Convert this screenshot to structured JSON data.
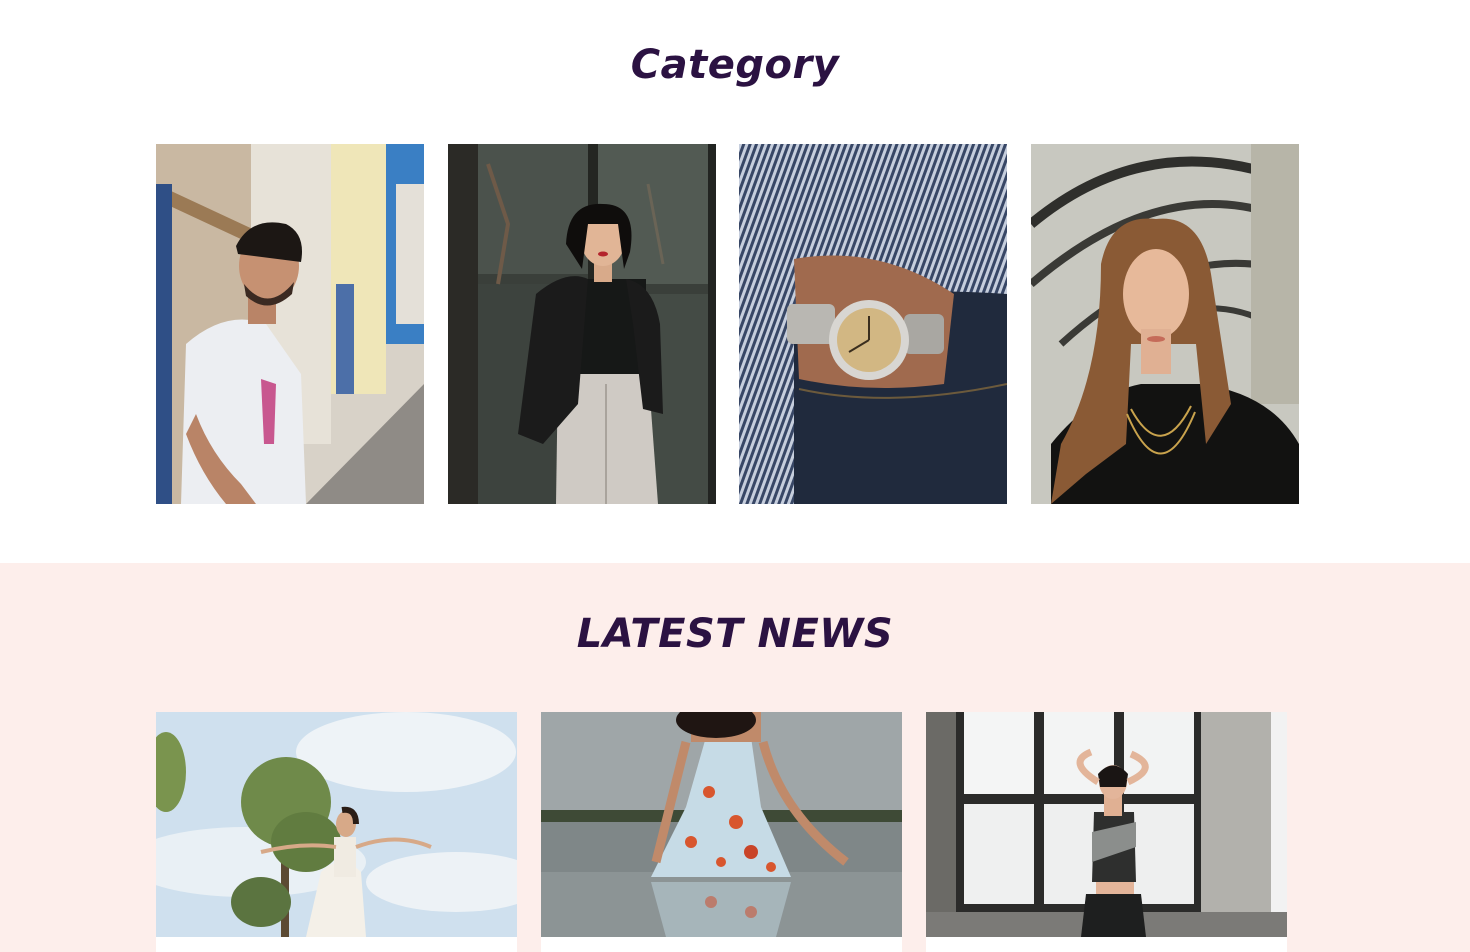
{
  "category": {
    "title": "Category",
    "items": [
      {
        "image": "man-white-tshirt-street-photo"
      },
      {
        "image": "woman-leather-jacket-door-photo"
      },
      {
        "image": "wristwatch-denim-pocket-photo"
      },
      {
        "image": "woman-long-hair-black-top-photo"
      }
    ]
  },
  "latest_news": {
    "title": "LATEST NEWS",
    "items": [
      {
        "image": "woman-white-dress-dancing-sky-photo"
      },
      {
        "image": "woman-floral-dress-lake-photo"
      },
      {
        "image": "woman-sportswear-window-photo"
      }
    ]
  },
  "colors": {
    "heading": "#2b1242",
    "news_background": "#fdeeeb",
    "page_background": "#ffffff"
  }
}
